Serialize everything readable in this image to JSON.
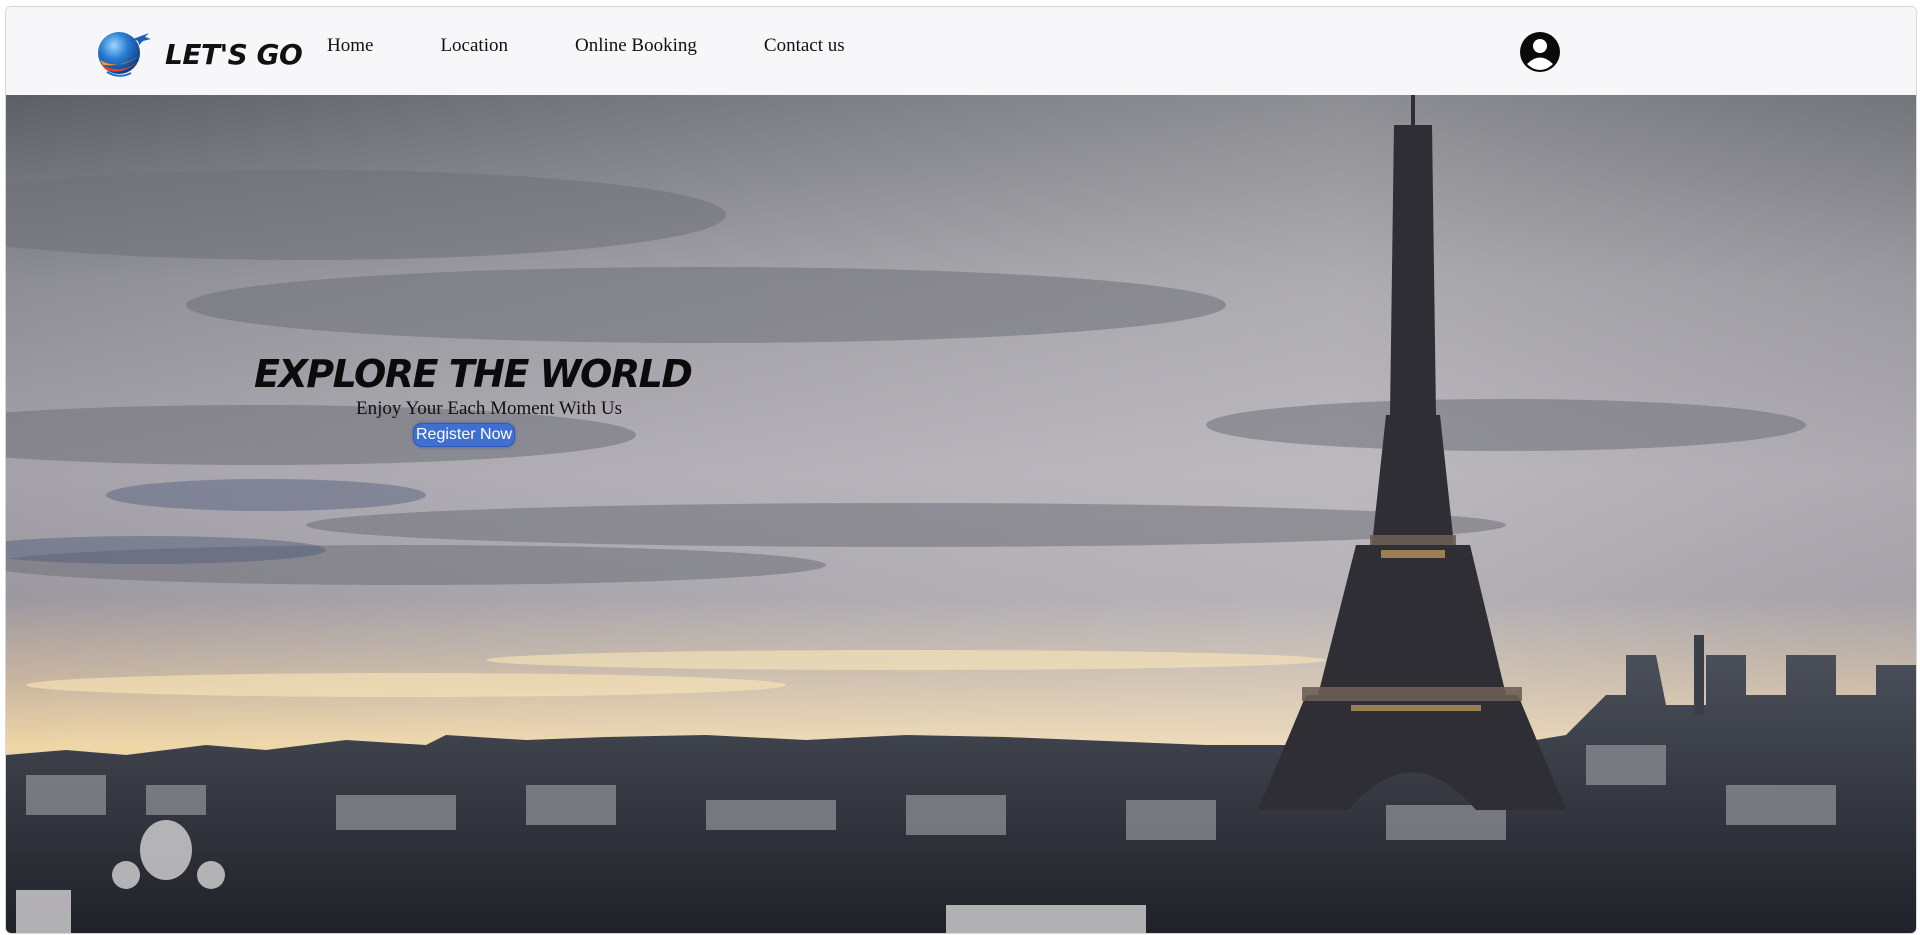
{
  "brand": {
    "name": "LET'S GO",
    "logo_icon": "globe-airplane-logo"
  },
  "nav": {
    "items": [
      {
        "label": "Home"
      },
      {
        "label": "Location"
      },
      {
        "label": "Online Booking"
      },
      {
        "label": "Contact us"
      }
    ]
  },
  "user": {
    "icon": "user-circle-icon"
  },
  "hero": {
    "title": "EXPLORE THE WORLD",
    "subtitle": "Enjoy Your Each Moment With Us",
    "cta_label": "Register Now",
    "background": "paris-skyline-eiffel-tower-image"
  },
  "colors": {
    "navbar_bg": "#f7f6f8",
    "cta_bg": "#3f6fd0",
    "text": "#111111"
  }
}
